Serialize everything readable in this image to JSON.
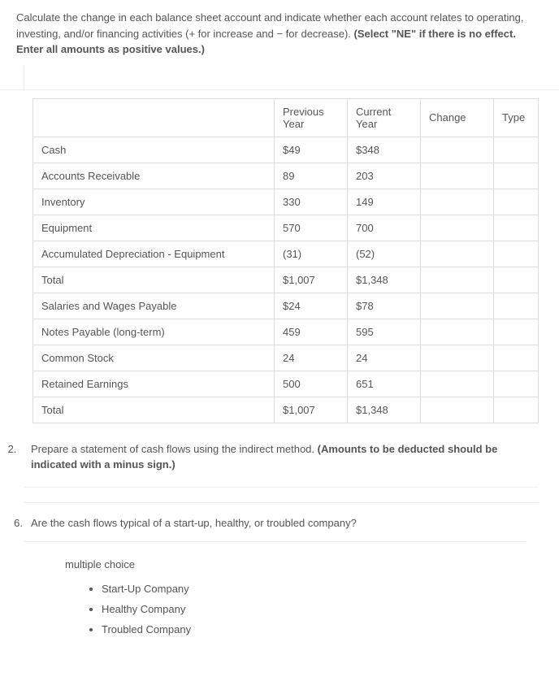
{
  "instructions": "Calculate the change in each balance sheet account and indicate whether each account relates to operating, investing, and/or financing activities (+ for increase and − for decrease). (Select \"NE\" if there is no effect. Enter all amounts as positive values.)",
  "table": {
    "headers": {
      "account": "",
      "previous": "Previous Year",
      "current": "Current Year",
      "change": "Change",
      "type": "Type"
    },
    "rows": [
      {
        "account": "Cash",
        "previous": "$49",
        "current": "$348"
      },
      {
        "account": "Accounts Receivable",
        "previous": "89",
        "current": "203"
      },
      {
        "account": "Inventory",
        "previous": "330",
        "current": "149"
      },
      {
        "account": "Equipment",
        "previous": "570",
        "current": "700"
      },
      {
        "account": "Accumulated Depreciation - Equipment",
        "previous": "(31)",
        "current": "(52)"
      },
      {
        "account": "Total",
        "previous": "$1,007",
        "current": "$1,348"
      },
      {
        "account": "Salaries and Wages Payable",
        "previous": "$24",
        "current": "$78"
      },
      {
        "account": "Notes Payable (long-term)",
        "previous": "459",
        "current": "595"
      },
      {
        "account": "Common Stock",
        "previous": "24",
        "current": "24"
      },
      {
        "account": "Retained Earnings",
        "previous": "500",
        "current": "651"
      },
      {
        "account": "Total",
        "previous": "$1,007",
        "current": "$1,348"
      }
    ]
  },
  "q2": {
    "num": "2.",
    "text": "Prepare a statement of cash flows using the indirect method. (Amounts to be deducted should be indicated with a minus sign.)"
  },
  "q6": {
    "num": "6.",
    "text": "Are the cash flows typical of a start-up, healthy, or troubled company?",
    "mc_label": "multiple choice",
    "choices": [
      "Start-Up Company",
      "Healthy Company",
      "Troubled Company"
    ]
  }
}
